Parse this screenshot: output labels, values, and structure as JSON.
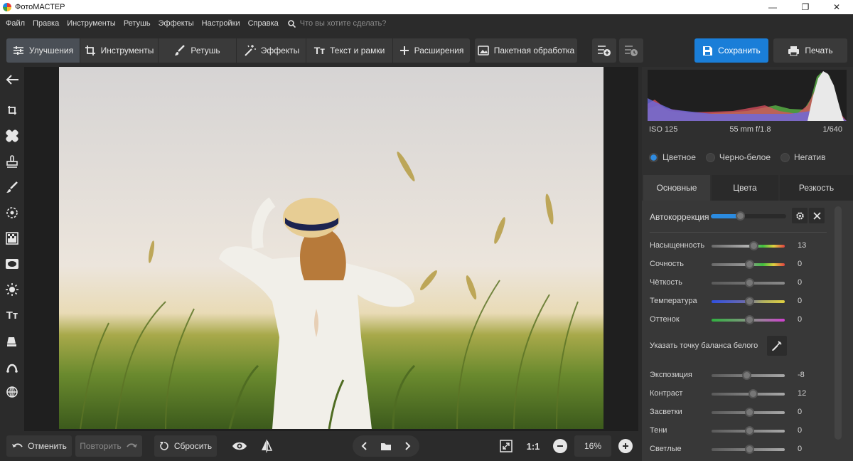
{
  "app": {
    "title": "ФотоМАСТЕР"
  },
  "window_controls": {
    "minimize": "—",
    "maximize": "❐",
    "close": "✕"
  },
  "menu": {
    "items": [
      "Файл",
      "Правка",
      "Инструменты",
      "Ретушь",
      "Эффекты",
      "Настройки",
      "Справка"
    ],
    "search_placeholder": "Что вы хотите сделать?"
  },
  "toolbar": {
    "tabs": [
      "Улучшения",
      "Инструменты",
      "Ретушь",
      "Эффекты",
      "Текст и рамки",
      "Расширения"
    ],
    "batch_label": "Пакетная обработка",
    "save_label": "Сохранить",
    "print_label": "Печать"
  },
  "bottom": {
    "undo_label": "Отменить",
    "redo_label": "Повторить",
    "reset_label": "Сбросить",
    "ratio_label": "1:1",
    "zoom_value": "16%"
  },
  "panel": {
    "exif": {
      "iso": "ISO 125",
      "lens": "55 mm f/1.8",
      "shutter": "1/640"
    },
    "color_modes": [
      "Цветное",
      "Черно-белое",
      "Негатив"
    ],
    "tabs": [
      "Основные",
      "Цвета",
      "Резкость"
    ],
    "autocorrection_label": "Автокоррекция",
    "white_balance_label": "Указать точку баланса белого",
    "sliders": [
      {
        "label": "Насыщенность",
        "value": "13"
      },
      {
        "label": "Сочность",
        "value": "0"
      },
      {
        "label": "Чёткость",
        "value": "0"
      },
      {
        "label": "Температура",
        "value": "0"
      },
      {
        "label": "Оттенок",
        "value": "0"
      },
      {
        "label": "Экспозиция",
        "value": "-8"
      },
      {
        "label": "Контраст",
        "value": "12"
      },
      {
        "label": "Засветки",
        "value": "0"
      },
      {
        "label": "Тени",
        "value": "0"
      },
      {
        "label": "Светлые",
        "value": "0"
      }
    ]
  },
  "colors": {
    "accent": "#1a7ed8",
    "background": "#2b2b2b",
    "panel": "#383838"
  }
}
